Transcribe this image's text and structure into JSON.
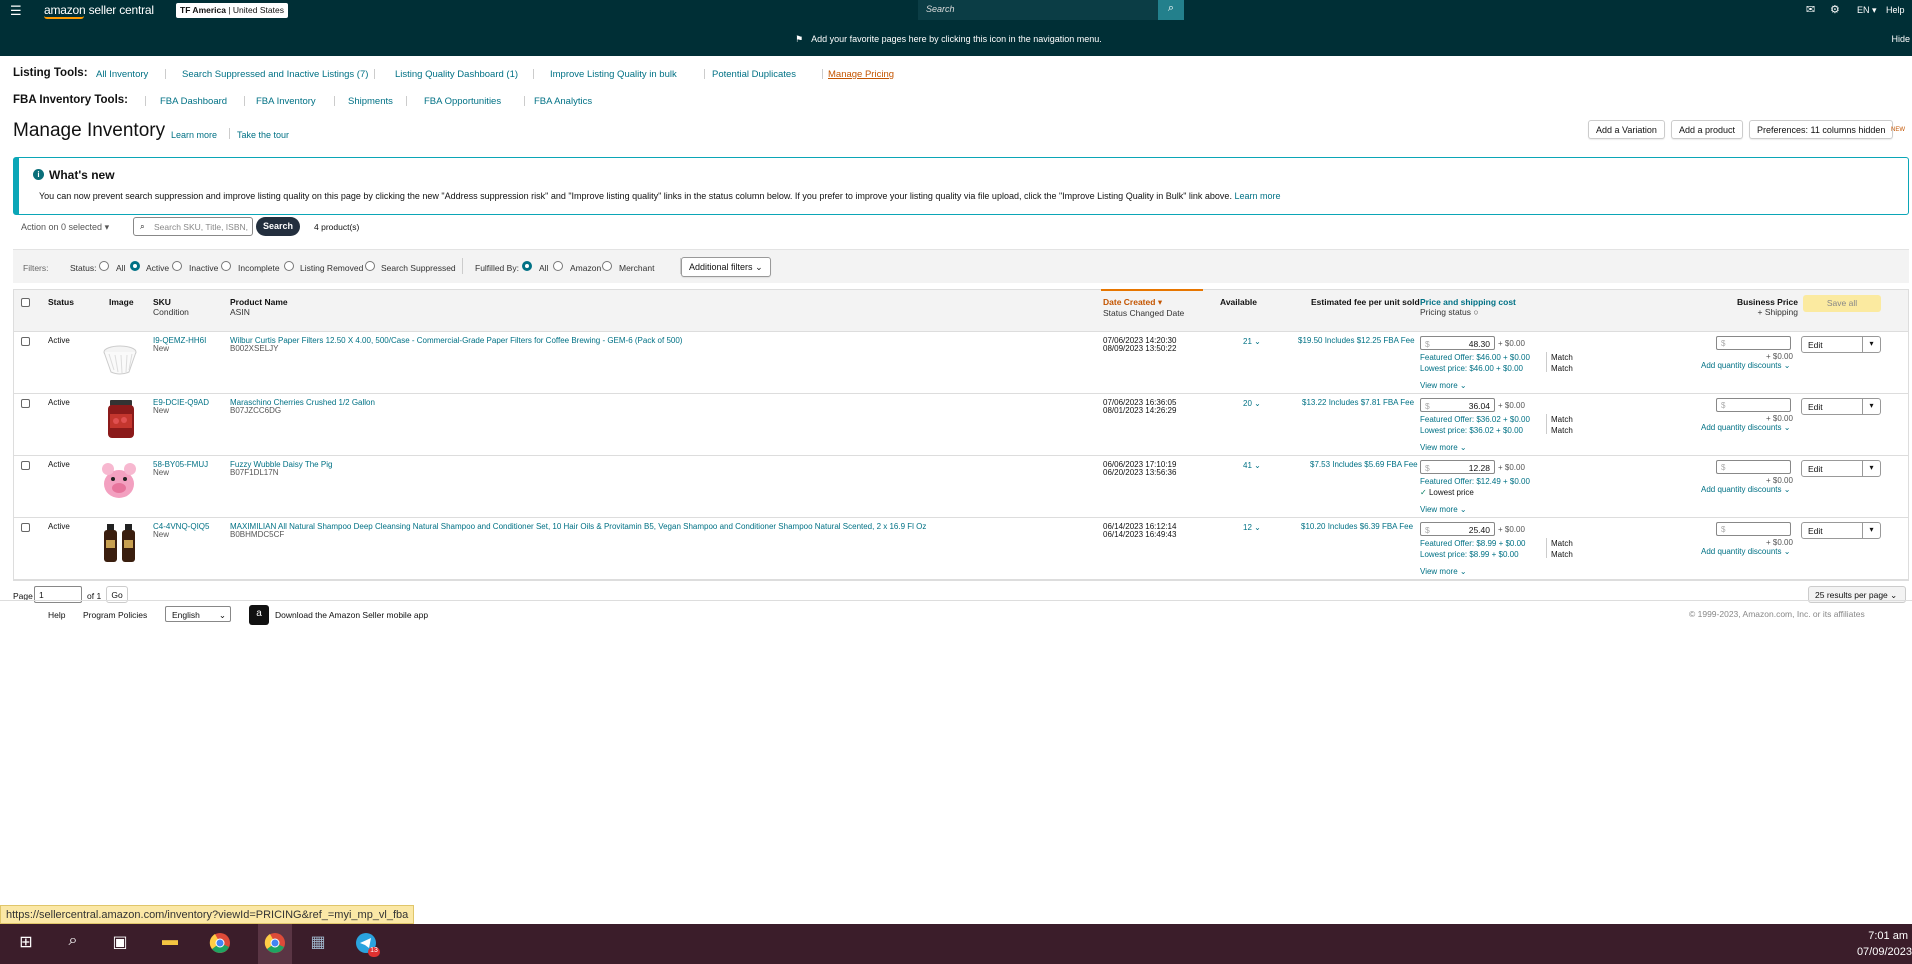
{
  "nav": {
    "logo": "amazon seller central",
    "marketplace_bold": "TF America",
    "marketplace_rest": " | United States",
    "search_placeholder": "Search",
    "lang": "EN",
    "help": "Help",
    "banner": "Add your favorite pages here by clicking this icon in the navigation menu.",
    "hide": "Hide"
  },
  "listing_tools": {
    "label": "Listing Tools:",
    "items": [
      "All Inventory",
      "Search Suppressed and Inactive Listings (7)",
      "Listing Quality Dashboard (1)",
      "Improve Listing Quality in bulk",
      "Potential Duplicates",
      "Manage Pricing"
    ]
  },
  "fba_tools": {
    "label": "FBA Inventory Tools:",
    "items": [
      "FBA Dashboard",
      "FBA Inventory",
      "Shipments",
      "FBA Opportunities",
      "FBA Analytics"
    ]
  },
  "page": {
    "title": "Manage Inventory",
    "learn_more": "Learn more",
    "tour": "Take the tour",
    "add_variation": "Add a Variation",
    "add_product": "Add a product",
    "preferences": "Preferences: 11 columns hidden",
    "new_badge": "NEW"
  },
  "whats_new": {
    "heading": "What's new",
    "text": "You can now prevent search suppression and improve listing quality on this page by clicking the new \"Address suppression risk\" and \"Improve listing quality\" links in the status column below. If you prefer to improve your listing quality via file upload, click the \"Improve Listing Quality in Bulk\" link above.",
    "link": "Learn more"
  },
  "actions": {
    "action_dropdown": "Action on 0 selected",
    "search_placeholder": "Search SKU, Title, ISBN,",
    "search_button": "Search",
    "count": "4 product(s)"
  },
  "filters": {
    "label": "Filters:",
    "status_label": "Status:",
    "status_options": [
      "All",
      "Active",
      "Inactive",
      "Incomplete",
      "Listing Removed",
      "Search Suppressed"
    ],
    "status_selected": "Active",
    "fulfilled_label": "Fulfilled By:",
    "fulfilled_options": [
      "All",
      "Amazon",
      "Merchant"
    ],
    "fulfilled_selected": "All",
    "additional": "Additional filters"
  },
  "columns": {
    "status": "Status",
    "image": "Image",
    "sku": "SKU",
    "condition": "Condition",
    "product_name": "Product Name",
    "asin": "ASIN",
    "date_created": "Date Created",
    "status_changed": "Status Changed Date",
    "available": "Available",
    "fee": "Estimated fee per unit sold",
    "price": "Price and shipping cost",
    "pricing_status": "Pricing status",
    "business_price": "Business Price",
    "shipping": "+ Shipping",
    "save_all": "Save all"
  },
  "rows": [
    {
      "status": "Active",
      "sku": "I9-QEMZ-HH6I",
      "condition": "New",
      "name": "Wilbur Curtis Paper Filters 12.50 X 4.00, 500/Case - Commercial-Grade Paper Filters for Coffee Brewing - GEM-6 (Pack of 500)",
      "asin": "B002XSELJY",
      "date": "07/06/2023 14:20:30",
      "changed": "08/09/2023 13:50:22",
      "available": "21",
      "fee": "$19.50 Includes $12.25 FBA Fee",
      "price": "48.30",
      "ship": "+ $0.00",
      "featured": "Featured Offer: $46.00 + $0.00",
      "lowest": "Lowest price: $46.00 + $0.00",
      "match1": "Match",
      "match2": "Match",
      "biz_ship": "+ $0.00",
      "qty": "Add quantity discounts",
      "view": "View more",
      "edit": "Edit"
    },
    {
      "status": "Active",
      "sku": "E9-DCIE-Q9AD",
      "condition": "New",
      "name": "Maraschino Cherries Crushed 1/2 Gallon",
      "asin": "B07JZCC6DG",
      "date": "07/06/2023 16:36:05",
      "changed": "08/01/2023 14:26:29",
      "available": "20",
      "fee": "$13.22 Includes $7.81 FBA Fee",
      "price": "36.04",
      "ship": "+ $0.00",
      "featured": "Featured Offer: $36.02 + $0.00",
      "lowest": "Lowest price: $36.02 + $0.00",
      "match1": "Match",
      "match2": "Match",
      "biz_ship": "+ $0.00",
      "qty": "Add quantity discounts",
      "view": "View more",
      "edit": "Edit"
    },
    {
      "status": "Active",
      "sku": "58-BY05-FMUJ",
      "condition": "New",
      "name": "Fuzzy Wubble Daisy The Pig",
      "asin": "B07F1DL17N",
      "date": "06/06/2023 17:10:19",
      "changed": "06/20/2023 13:56:36",
      "available": "41",
      "fee": "$7.53 Includes $5.69 FBA Fee",
      "price": "12.28",
      "ship": "+ $0.00",
      "featured": "Featured Offer: $12.49 + $0.00",
      "lowest_badge": "Lowest price",
      "biz_ship": "+ $0.00",
      "qty": "Add quantity discounts",
      "view": "View more",
      "edit": "Edit"
    },
    {
      "status": "Active",
      "sku": "C4-4VNQ-QIQ5",
      "condition": "New",
      "name": "MAXIMILIAN All Natural Shampoo Deep Cleansing Natural Shampoo and Conditioner Set, 10 Hair Oils & Provitamin B5, Vegan Shampoo and Conditioner Shampoo Natural Scented, 2 x 16.9 Fl Oz",
      "asin": "B0BHMDC5CF",
      "date": "06/14/2023 16:12:14",
      "changed": "06/14/2023 16:49:43",
      "available": "12",
      "fee": "$10.20 Includes $6.39 FBA Fee",
      "price": "25.40",
      "ship": "+ $0.00",
      "featured": "Featured Offer: $8.99 + $0.00",
      "lowest": "Lowest price: $8.99 + $0.00",
      "match1": "Match",
      "match2": "Match",
      "biz_ship": "+ $0.00",
      "qty": "Add quantity discounts",
      "view": "View more",
      "edit": "Edit"
    }
  ],
  "pagination": {
    "page_label": "Page",
    "page_value": "1",
    "of": "of 1",
    "go": "Go",
    "per_page": "25 results per page"
  },
  "footer": {
    "help": "Help",
    "policies": "Program Policies",
    "language": "English",
    "app": "Download the Amazon Seller mobile app",
    "copyright": "© 1999-2023, Amazon.com, Inc. or its affiliates"
  },
  "status_url": "https://sellercentral.amazon.com/inventory?viewId=PRICING&ref_=myi_mp_vl_fba",
  "clock": {
    "time": "7:01 am",
    "date": "07/09/2023"
  },
  "taskbar_badge": "13"
}
